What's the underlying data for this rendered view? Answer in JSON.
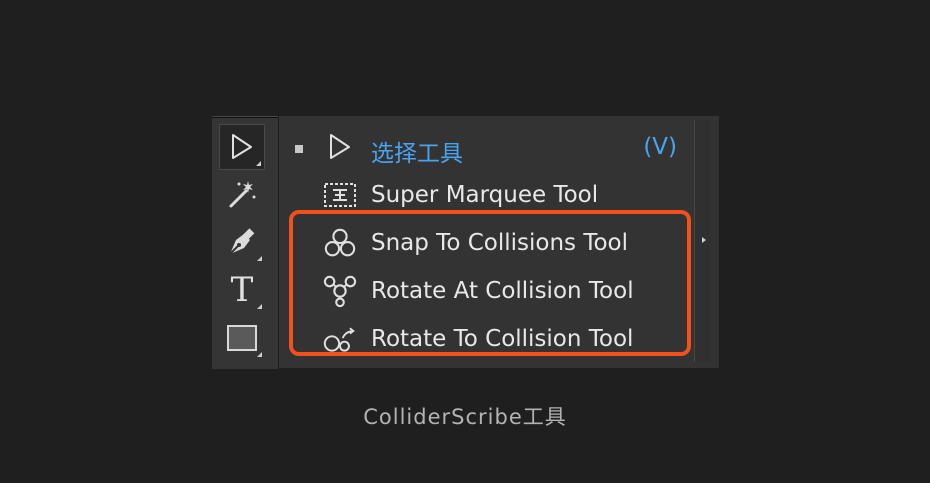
{
  "toolbar": {
    "tools": [
      {
        "name": "selection-tool",
        "icon": "arrow-cursor-icon",
        "active": true
      },
      {
        "name": "magic-wand-tool",
        "icon": "magic-wand-icon"
      },
      {
        "name": "pen-tool",
        "icon": "pen-nib-icon"
      },
      {
        "name": "type-tool",
        "icon": "type-t-icon",
        "glyph": "T"
      },
      {
        "name": "rectangle-tool",
        "icon": "rectangle-icon"
      }
    ]
  },
  "flyout": {
    "items": [
      {
        "label": "选择工具",
        "shortcut": "(V)",
        "icon": "arrow-cursor-icon",
        "selected": true
      },
      {
        "label": "Super Marquee Tool",
        "icon": "super-marquee-icon"
      },
      {
        "label": "Snap To Collisions Tool",
        "icon": "snap-collisions-icon"
      },
      {
        "label": "Rotate At Collision Tool",
        "icon": "rotate-at-collision-icon"
      },
      {
        "label": "Rotate To Collision Tool",
        "icon": "rotate-to-collision-icon"
      }
    ]
  },
  "caption": "ColliderScribe工具",
  "colors": {
    "background": "#1f1f1f",
    "panel": "#333333",
    "accent_blue": "#4aa3ee",
    "highlight_orange": "#f2511b"
  }
}
